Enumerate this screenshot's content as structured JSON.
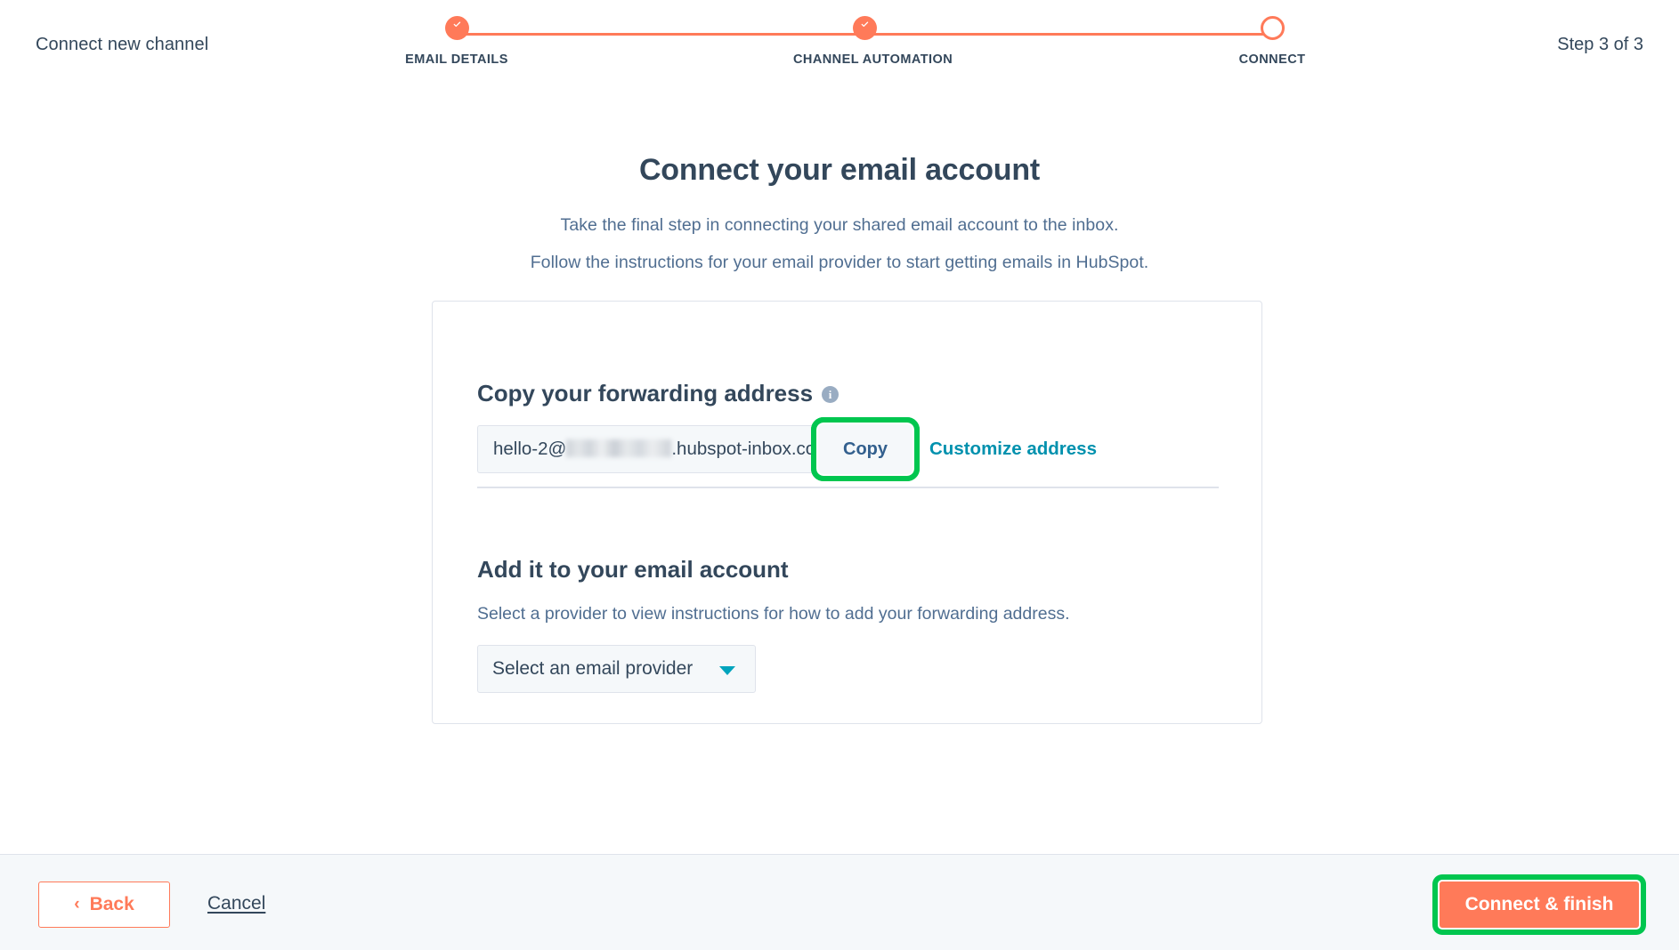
{
  "topbar": {
    "title": "Connect new channel",
    "step_count": "Step 3 of 3",
    "steps": [
      {
        "label": "EMAIL DETAILS",
        "state": "complete",
        "icon": "check-icon"
      },
      {
        "label": "CHANNEL AUTOMATION",
        "state": "complete",
        "icon": "check-icon"
      },
      {
        "label": "CONNECT",
        "state": "current",
        "icon": "circle-outline-icon"
      }
    ]
  },
  "main": {
    "heading": "Connect your email account",
    "subtitle_line1": "Take the final step in connecting your shared email account to the inbox.",
    "subtitle_line2": "Follow the instructions for your email provider to start getting emails in HubSpot.",
    "card": {
      "section1_title": "Copy your forwarding address",
      "info_icon_glyph": "i",
      "forwarding_address_prefix": "hello-2@",
      "forwarding_address_suffix": ".hubspot-inbox.com",
      "forwarding_address_redacted": true,
      "copy_button_label": "Copy",
      "customize_link_label": "Customize address",
      "section2_title": "Add it to your email account",
      "section2_description": "Select a provider to view instructions for how to add your forwarding address.",
      "provider_select_value": "Select an email provider",
      "provider_select_icon": "chevron-down-icon"
    }
  },
  "footer": {
    "back_label": "Back",
    "back_icon": "chevron-left-icon",
    "back_chevron_glyph": "‹",
    "cancel_label": "Cancel",
    "finish_label": "Connect & finish"
  },
  "colors": {
    "brand_orange": "#ff7a59",
    "text_dark": "#33475b",
    "text_muted": "#506e91",
    "link_teal": "#0091ae",
    "caret_teal": "#00a4bd",
    "field_bg": "#f5f8fa",
    "border": "#dfe3eb",
    "highlight_green": "#00c64f"
  }
}
